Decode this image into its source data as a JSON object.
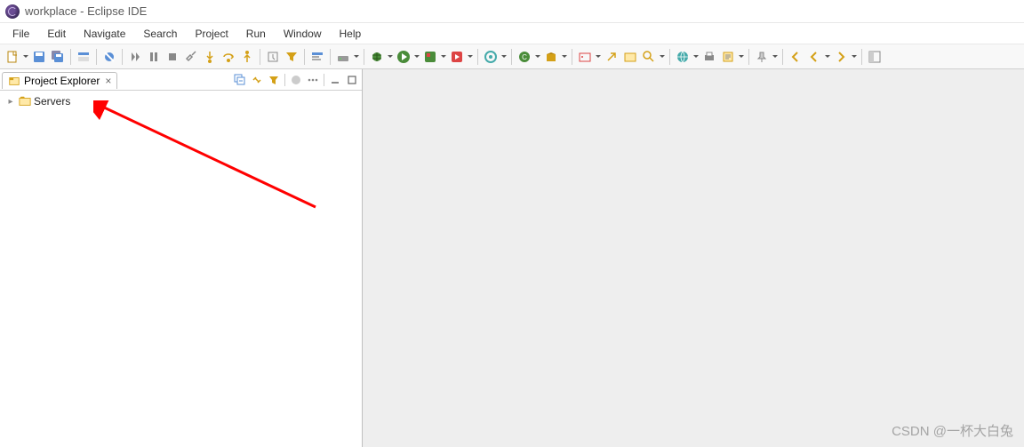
{
  "titlebar": {
    "title": "workplace - Eclipse IDE"
  },
  "menubar": [
    "File",
    "Edit",
    "Navigate",
    "Search",
    "Project",
    "Run",
    "Window",
    "Help"
  ],
  "panel": {
    "tab_label": "Project Explorer",
    "tree_items": [
      {
        "label": "Servers",
        "expandable": true
      }
    ]
  },
  "watermark": "CSDN @一杯大白兔"
}
